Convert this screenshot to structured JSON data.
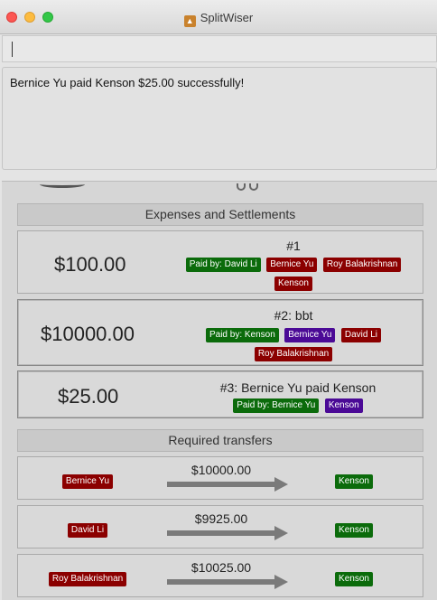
{
  "window": {
    "title": "SplitWiser"
  },
  "command": {
    "value": ""
  },
  "result": {
    "message": "Bernice Yu paid Kenson $25.00 successfully!"
  },
  "expenses": {
    "heading": "Expenses and Settlements",
    "items": [
      {
        "amount": "$100.00",
        "title": "#1",
        "paid_by": "Paid by: David Li",
        "participants": [
          "Bernice Yu",
          "Roy Balakrishnan",
          "Kenson"
        ]
      },
      {
        "amount": "$10000.00",
        "title": "#2: bbt",
        "paid_by": "Paid by: Kenson",
        "participants": [
          "Bernice Yu",
          "David Li",
          "Roy Balakrishnan"
        ]
      },
      {
        "amount": "$25.00",
        "title": "#3: Bernice Yu paid Kenson",
        "paid_by": "Paid by: Bernice Yu",
        "participants": [
          "Kenson"
        ]
      }
    ]
  },
  "transfers": {
    "heading": "Required transfers",
    "items": [
      {
        "from": "Bernice Yu",
        "amount": "$10000.00",
        "to": "Kenson"
      },
      {
        "from": "David Li",
        "amount": "$9925.00",
        "to": "Kenson"
      },
      {
        "from": "Roy Balakrishnan",
        "amount": "$10025.00",
        "to": "Kenson"
      }
    ]
  },
  "colors": {
    "paid_tag": "#0b6b0b",
    "participant_tag": "#8b0000",
    "settlement_tag": "#4b0a96"
  }
}
